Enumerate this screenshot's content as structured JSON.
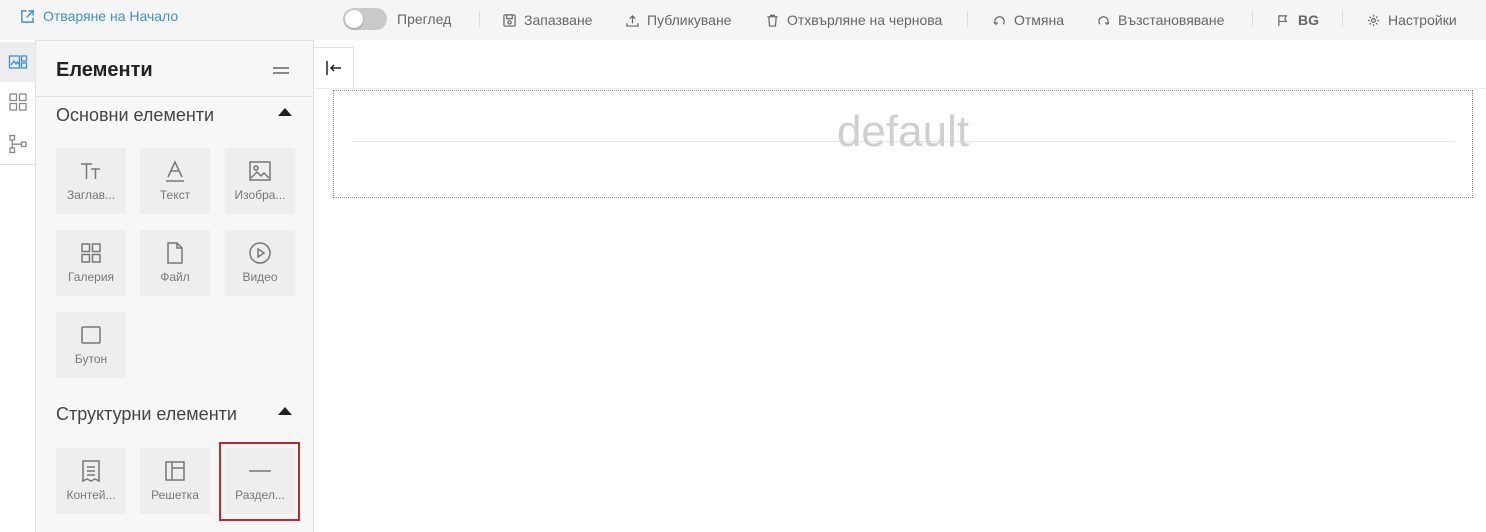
{
  "header": {
    "open_home_label": "Отваряне на Начало",
    "preview_label": "Преглед",
    "save_label": "Запазване",
    "publish_label": "Публикуване",
    "discard_label": "Отхвърляне на чернова",
    "undo_label": "Отмяна",
    "redo_label": "Възстановяване",
    "language_label": "BG",
    "settings_label": "Настройки"
  },
  "panel": {
    "title": "Елементи",
    "basic_section": {
      "title": "Основни елементи",
      "items": [
        {
          "label": "Заглав...",
          "icon": "heading-icon"
        },
        {
          "label": "Текст",
          "icon": "text-icon"
        },
        {
          "label": "Изобра...",
          "icon": "image-icon"
        },
        {
          "label": "Галерия",
          "icon": "gallery-icon"
        },
        {
          "label": "Файл",
          "icon": "file-icon"
        },
        {
          "label": "Видео",
          "icon": "video-icon"
        },
        {
          "label": "Бутон",
          "icon": "button-icon"
        }
      ]
    },
    "structure_section": {
      "title": "Структурни елементи",
      "items": [
        {
          "label": "Контей...",
          "icon": "container-icon"
        },
        {
          "label": "Решетка",
          "icon": "grid-icon"
        },
        {
          "label": "Раздел...",
          "icon": "divider-icon"
        }
      ]
    }
  },
  "canvas": {
    "placeholder_text": "default"
  },
  "colors": {
    "accent": "#3d8fd9",
    "highlight": "#c0282d",
    "tile_bg": "#eeeeee",
    "panel_bg": "#f7f7f7"
  }
}
